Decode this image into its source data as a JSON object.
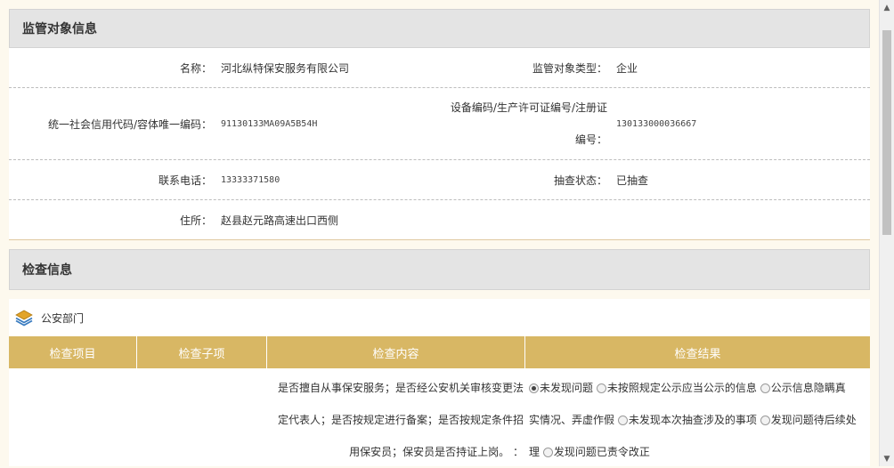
{
  "supervision": {
    "title": "监管对象信息",
    "rows": [
      {
        "label": "名称：",
        "value": "河北纵特保安服务有限公司",
        "label2": "监管对象类型：",
        "value2": "企业"
      },
      {
        "label": "统一社会信用代码/容体唯一编码：",
        "value": "91130133MA09A5B54H",
        "label2_line1": "设备编码/生产许可证编号/注册证",
        "label2_line2": "编号：",
        "value2": "130133000036667"
      },
      {
        "label": "联系电话：",
        "value": "13333371580",
        "label2": "抽查状态：",
        "value2": "已抽查"
      },
      {
        "label": "住所：",
        "value": "赵县赵元路高速出口西侧"
      }
    ]
  },
  "inspection": {
    "title": "检查信息",
    "department": "公安部门",
    "columns": [
      "检查项目",
      "检查子项",
      "检查内容",
      "检查结果"
    ],
    "content_lines": [
      "是否擅自从事保安服务；是否经公安机关审核变更法",
      "定代表人；是否按规定进行备案；是否按规定条件招",
      "用保安员；保安员是否持证上岗。 ："
    ],
    "result_options": [
      {
        "label": "未发现问题",
        "checked": true
      },
      {
        "label": "未按照规定公示应当公示的信息",
        "checked": false
      },
      {
        "label": "公示信息隐瞒真",
        "checked": false
      },
      {
        "label": "实情况、弄虚作假",
        "checked": false
      },
      {
        "label": "未发现本次抽查涉及的事项",
        "checked": false
      },
      {
        "label": "发现问题待后续处",
        "checked": false
      },
      {
        "label": "理",
        "checked": false
      },
      {
        "label": "发现问题已责令改正",
        "checked": false
      }
    ]
  },
  "colors": {
    "header_gold": "#d8b764",
    "section_gray": "#e4e4e4",
    "background": "#fdf9ee"
  },
  "icons": {
    "department": "layers-icon",
    "scroll_up": "arrow-up-icon",
    "scroll_down": "arrow-down-icon"
  }
}
